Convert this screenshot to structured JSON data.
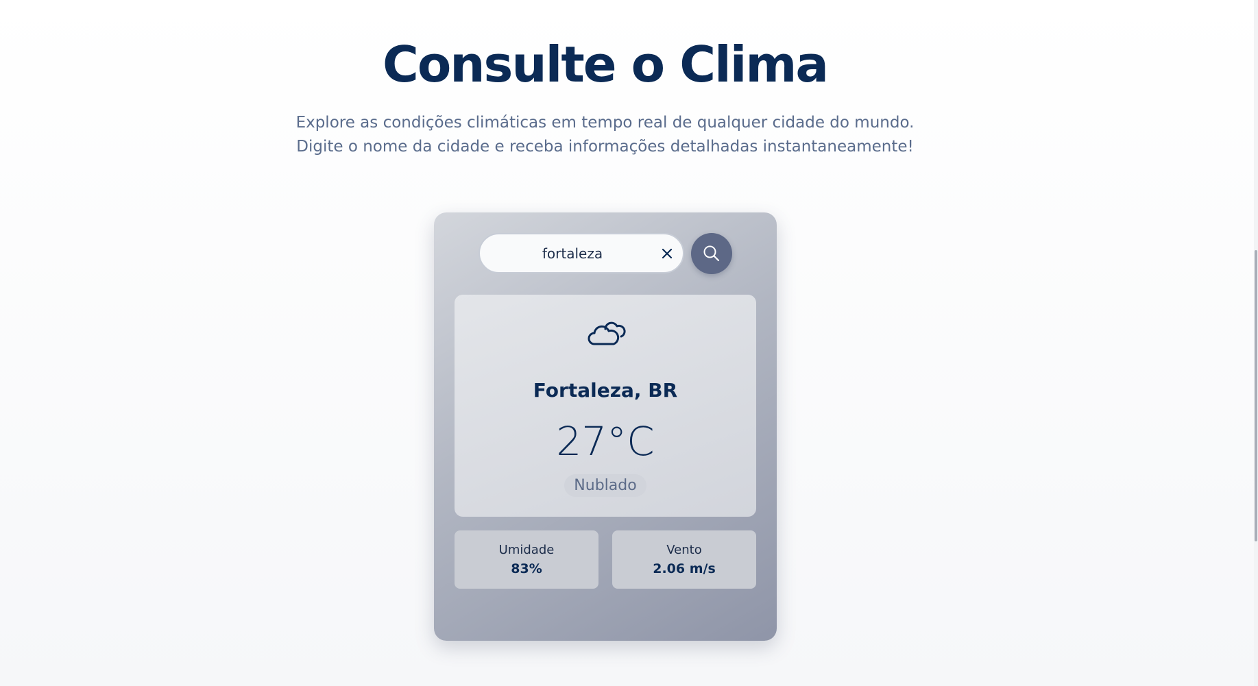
{
  "header": {
    "title": "Consulte o Clima",
    "subtitle": "Explore as condições climáticas em tempo real de qualquer cidade do mundo. Digite o nome da cidade e receba informações detalhadas instantaneamente!"
  },
  "search": {
    "value": "fortaleza",
    "clear_icon": "close-icon",
    "submit_icon": "search-icon"
  },
  "weather": {
    "icon": "cloud-icon",
    "city": "Fortaleza, BR",
    "temperature": "27°C",
    "condition": "Nublado"
  },
  "stats": {
    "humidity": {
      "label": "Umidade",
      "value": "83%"
    },
    "wind": {
      "label": "Vento",
      "value": "2.06 m/s"
    }
  },
  "colors": {
    "title": "#0b2a55",
    "subtitle": "#5a6c8c",
    "search_button": "#5d6886"
  }
}
